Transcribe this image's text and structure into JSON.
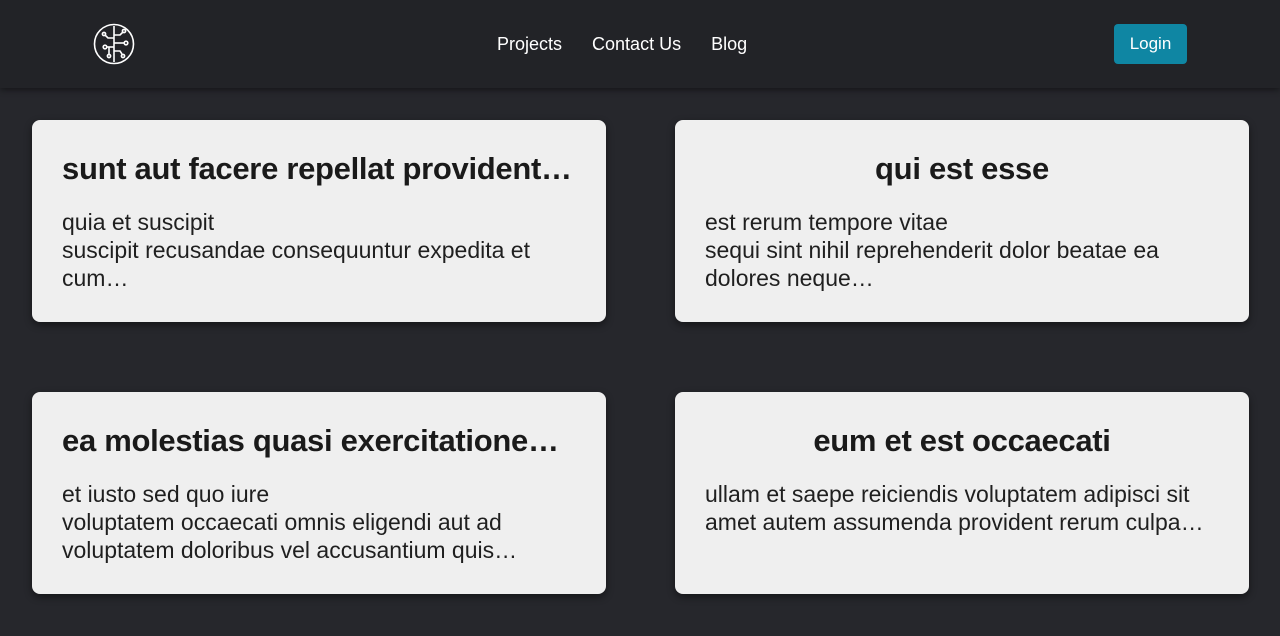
{
  "nav": {
    "logo": "circuit-brain-logo",
    "links": [
      "Projects",
      "Contact Us",
      "Blog"
    ],
    "login_label": "Login",
    "accent_color": "#0f86a3"
  },
  "posts": [
    {
      "title": "sunt aut facere repellat provident occaecati excepturi optio reprehenderit",
      "body": "quia et suscipit\nsuscipit recusandae consequuntur expedita et cum…"
    },
    {
      "title": "qui est esse",
      "body": "est rerum tempore vitae\nsequi sint nihil reprehenderit dolor beatae ea dolores neque…"
    },
    {
      "title": "ea molestias quasi exercitationem repellat qui ipsa sit aut",
      "body": "et iusto sed quo iure\nvoluptatem occaecati omnis eligendi aut ad voluptatem doloribus vel accusantium quis…"
    },
    {
      "title": "eum et est occaecati",
      "body": "ullam et saepe reiciendis voluptatem adipisci sit amet autem assumenda provident rerum culpa…"
    }
  ]
}
